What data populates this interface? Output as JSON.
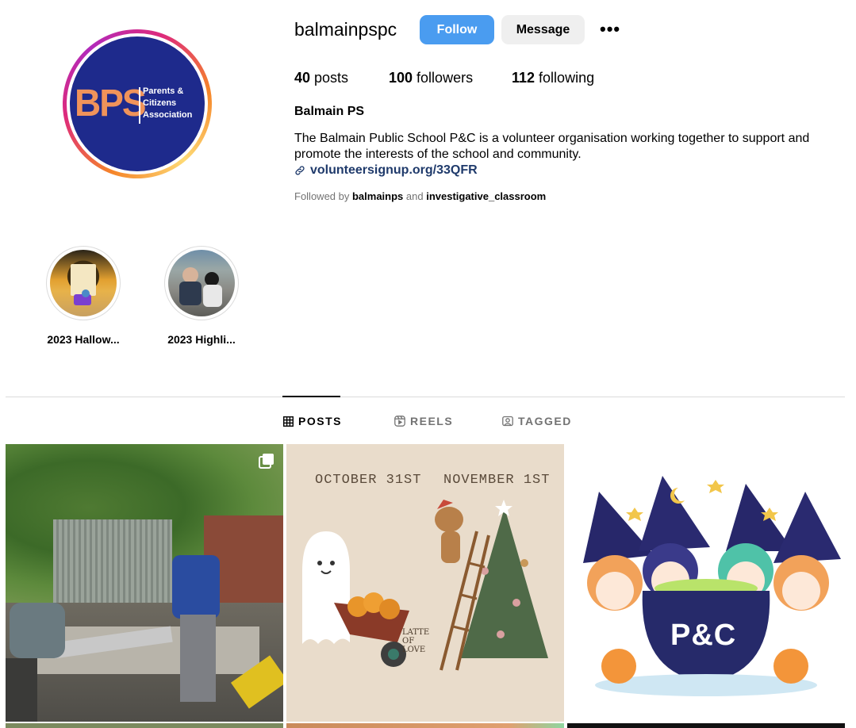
{
  "profile": {
    "username": "balmainpspc",
    "follow_label": "Follow",
    "message_label": "Message",
    "more_label": "•••",
    "stats": {
      "posts_count": "40",
      "posts_label": " posts",
      "followers_count": "100",
      "followers_label": " followers",
      "following_count": "112",
      "following_label": " following"
    },
    "full_name": "Balmain PS",
    "bio": "The Balmain Public School P&C is a volunteer organisation working together to support and promote the interests of the school and community.",
    "link": "volunteersignup.org/33QFR",
    "followed_by_prefix": "Followed by ",
    "followed_by_user1": "balmainps",
    "followed_by_and": " and ",
    "followed_by_user2": "investigative_classroom"
  },
  "avatar": {
    "logo_text": "BPS",
    "line1": "Parents &",
    "line2": "Citizens",
    "line3": "Association"
  },
  "highlights": [
    {
      "label": "2023 Hallow..."
    },
    {
      "label": "2023 Highli..."
    }
  ],
  "tabs": [
    {
      "label": "POSTS",
      "icon": "grid-icon",
      "active": true
    },
    {
      "label": "REELS",
      "icon": "reels-icon",
      "active": false
    },
    {
      "label": "TAGGED",
      "icon": "tagged-icon",
      "active": false
    }
  ],
  "posts": [
    {
      "kind": "photo",
      "multi": true
    },
    {
      "kind": "illustration",
      "left_caption": "OCTOBER 31ST",
      "right_caption": "NOVEMBER 1ST",
      "signature": "LATTE OF LOVE"
    },
    {
      "kind": "illustration",
      "cauldron_text": "P&C"
    }
  ],
  "colors": {
    "follow_blue": "#4a9cf0",
    "avatar_navy": "#1e2a8c",
    "logo_orange": "#f0935a",
    "link_blue": "#1f3a6b"
  }
}
